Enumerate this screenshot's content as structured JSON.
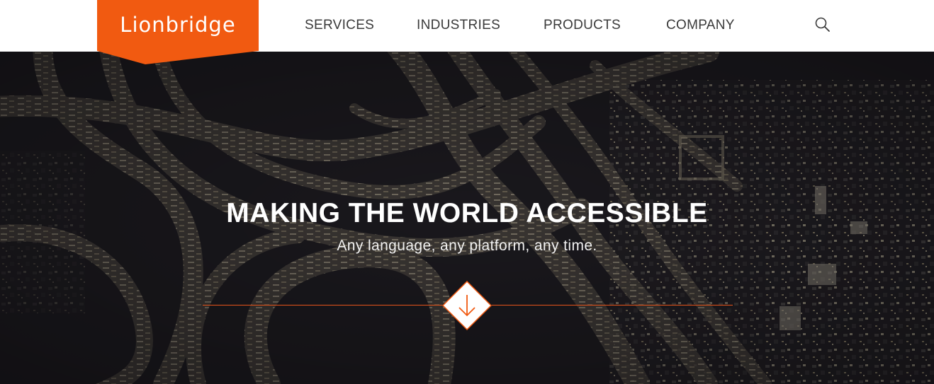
{
  "brand": {
    "name": "Lionbridge",
    "accent_color": "#f15a11"
  },
  "nav": {
    "items": [
      {
        "label": "SERVICES"
      },
      {
        "label": "INDUSTRIES"
      },
      {
        "label": "PRODUCTS"
      },
      {
        "label": "COMPANY"
      }
    ],
    "search_icon": "search-icon"
  },
  "hero": {
    "title": "MAKING THE WORLD ACCESSIBLE",
    "subtitle": "Any language, any platform, any time.",
    "scroll_icon": "arrow-down-icon",
    "background": "aerial-highway-interchange-night"
  }
}
